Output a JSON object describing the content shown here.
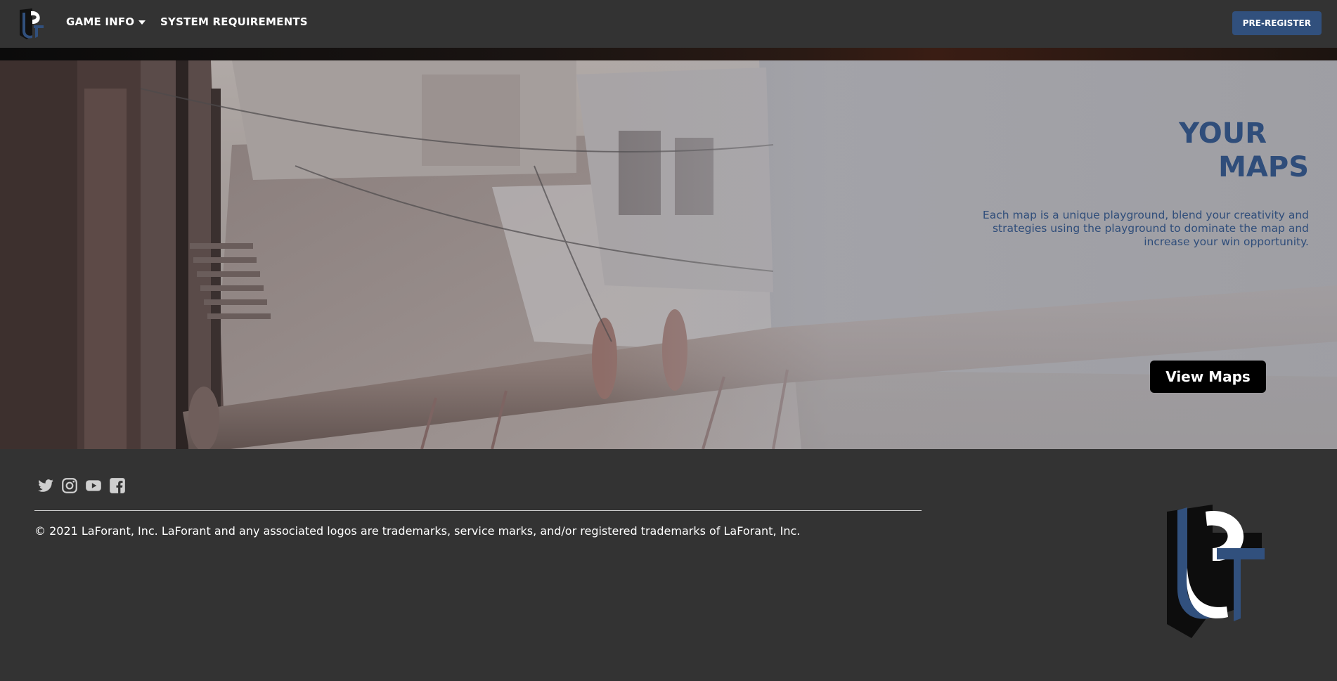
{
  "nav": {
    "game_info": "GAME INFO",
    "system_requirements": "SYSTEM REQUIREMENTS",
    "pre_register": "PRE-REGISTER"
  },
  "hero": {
    "title_line1": "YOUR",
    "title_line2": "MAPS",
    "description": "Each map is a unique playground, blend your creativity and strategies using the playground to dominate the map and increase your win opportunity.",
    "button": "View Maps"
  },
  "footer": {
    "socials": [
      "twitter-icon",
      "instagram-icon",
      "youtube-icon",
      "facebook-icon"
    ],
    "copyright": "© 2021 LaForant, Inc. LaForant and any associated logos are trademarks, service marks, and/or registered trademarks of LaForant, Inc."
  },
  "colors": {
    "background": "#333333",
    "accent": "#31507d",
    "title_text": "#2f4d7a"
  }
}
